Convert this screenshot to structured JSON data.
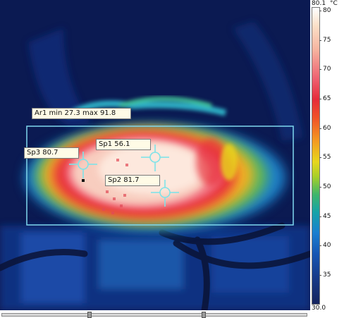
{
  "measurements": {
    "area": {
      "name": "Ar1",
      "min_label": "min",
      "min": "27.3",
      "max_label": "max",
      "max": "91.8"
    },
    "spots": [
      {
        "name": "Sp1",
        "value": "56.1"
      },
      {
        "name": "Sp2",
        "value": "81.7"
      },
      {
        "name": "Sp3",
        "value": "80.7"
      }
    ]
  },
  "labels": {
    "area": "Ar1 min 27.3 max 91.8",
    "sp1": "Sp1 56.1",
    "sp2": "Sp2 81.7",
    "sp3": "Sp3 80.7"
  },
  "scale": {
    "max": "80.1",
    "unit": "°C",
    "min": "30.0",
    "ticks": [
      "80",
      "75",
      "70",
      "65",
      "60",
      "55",
      "50",
      "45",
      "40",
      "35"
    ]
  },
  "colors": {
    "roi": "#7fd8ee",
    "crosshair": "#7fe3e8",
    "background": "#0b1a52"
  }
}
